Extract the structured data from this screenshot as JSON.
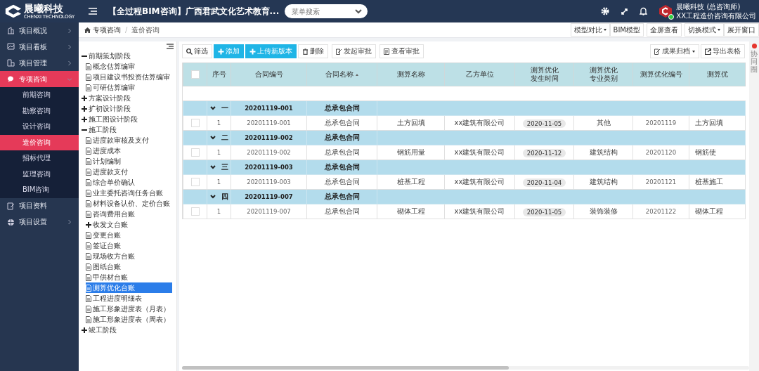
{
  "brand": {
    "name": "晨曦科技",
    "tagline": "CHENXI TECHNOLOGY"
  },
  "header": {
    "title": "【全过程BIM咨询】广西君武文化艺术教育...",
    "search_placeholder": "菜单搜索",
    "user_name": "晨曦科技 (总咨询师)",
    "company": "XX工程造价咨询有限公司",
    "online": true
  },
  "sidebar": {
    "items": [
      {
        "label": "项目概况",
        "selected": false,
        "expanded": false,
        "has_arrow": true
      },
      {
        "label": "项目看板",
        "selected": false,
        "expanded": false,
        "has_arrow": true
      },
      {
        "label": "项目管理",
        "selected": false,
        "expanded": false,
        "has_arrow": true
      },
      {
        "label": "专项咨询",
        "selected": true,
        "expanded": true,
        "has_arrow": true,
        "children": [
          {
            "label": "前期咨询",
            "selected": false
          },
          {
            "label": "勘察咨询",
            "selected": false
          },
          {
            "label": "设计咨询",
            "selected": false
          },
          {
            "label": "造价咨询",
            "selected": true
          },
          {
            "label": "招标代理",
            "selected": false
          },
          {
            "label": "监理咨询",
            "selected": false
          },
          {
            "label": "BIM咨询",
            "selected": false
          }
        ]
      },
      {
        "label": "项目资料",
        "selected": false,
        "expanded": false,
        "has_arrow": false
      },
      {
        "label": "项目设置",
        "selected": false,
        "expanded": false,
        "has_arrow": true
      }
    ]
  },
  "breadcrumb": {
    "separator": "/",
    "items": [
      "专项咨询",
      "造价咨询"
    ]
  },
  "view_buttons": [
    {
      "label": "模型对比",
      "dropdown": true
    },
    {
      "label": "BIM模型",
      "dropdown": false
    },
    {
      "label": "全屏查看",
      "dropdown": false
    },
    {
      "label": "切换模式",
      "dropdown": true
    },
    {
      "label": "展开窗口",
      "dropdown": false
    }
  ],
  "tree": [
    {
      "label": "前期策划阶段",
      "kind": "folder",
      "expanded": true,
      "selected": false,
      "children": [
        {
          "label": "概念估算编审",
          "kind": "doc",
          "selected": false
        },
        {
          "label": "项目建议书投资估算编审",
          "kind": "doc",
          "selected": false
        },
        {
          "label": "可研估算编审",
          "kind": "doc",
          "selected": false
        }
      ]
    },
    {
      "label": "方案设计阶段",
      "kind": "folder",
      "expanded": false,
      "selected": false
    },
    {
      "label": "扩初设计阶段",
      "kind": "folder",
      "expanded": false,
      "selected": false
    },
    {
      "label": "施工图设计阶段",
      "kind": "folder",
      "expanded": false,
      "selected": false
    },
    {
      "label": "施工阶段",
      "kind": "folder",
      "expanded": true,
      "selected": false,
      "children": [
        {
          "label": "进度款审核及支付",
          "kind": "doc",
          "selected": false
        },
        {
          "label": "进度成本",
          "kind": "doc",
          "selected": false
        },
        {
          "label": "计划编制",
          "kind": "doc",
          "selected": false
        },
        {
          "label": "进度款支付",
          "kind": "doc",
          "selected": false
        },
        {
          "label": "综合单价确认",
          "kind": "doc",
          "selected": false
        },
        {
          "label": "业主委托咨询任务台账",
          "kind": "doc",
          "selected": false
        },
        {
          "label": "材料设备认价、定价台账",
          "kind": "doc",
          "selected": false
        },
        {
          "label": "咨询费用台账",
          "kind": "doc",
          "selected": false
        },
        {
          "label": "收发文台账",
          "kind": "folder",
          "expanded": false,
          "selected": false
        },
        {
          "label": "变更台账",
          "kind": "doc",
          "selected": false
        },
        {
          "label": "签证台账",
          "kind": "doc",
          "selected": false
        },
        {
          "label": "现场收方台账",
          "kind": "doc",
          "selected": false
        },
        {
          "label": "图纸台账",
          "kind": "doc",
          "selected": false
        },
        {
          "label": "甲供材台账",
          "kind": "doc",
          "selected": false
        },
        {
          "label": "测算优化台账",
          "kind": "doc",
          "selected": true
        },
        {
          "label": "工程进度明细表",
          "kind": "doc",
          "selected": false
        },
        {
          "label": "施工形象进度表（月表）",
          "kind": "doc",
          "selected": false
        },
        {
          "label": "施工形象进度表（周表）",
          "kind": "doc",
          "selected": false
        }
      ]
    },
    {
      "label": "竣工阶段",
      "kind": "folder",
      "expanded": false,
      "selected": false
    }
  ],
  "toolbar": [
    {
      "label": "筛选",
      "kind": "search",
      "primary": false
    },
    {
      "label": "添加",
      "kind": "plus",
      "primary": true
    },
    {
      "label": "上传新版本",
      "kind": "plus",
      "primary": true
    },
    {
      "label": "删除",
      "kind": "trash",
      "primary": false
    },
    {
      "label": "发起审批",
      "kind": "edit",
      "primary": false
    },
    {
      "label": "查看审批",
      "kind": "doc",
      "primary": false
    }
  ],
  "toolbar_right": [
    {
      "label": "成果归档",
      "kind": "edit",
      "dropdown": true
    },
    {
      "label": "导出表格",
      "kind": "export",
      "dropdown": false
    }
  ],
  "table": {
    "select_all": false,
    "columns": [
      {
        "label": "序号",
        "sortable": false
      },
      {
        "label": "合同编号",
        "sortable": false
      },
      {
        "label": "合同名称",
        "sortable": true
      },
      {
        "label": "测算名称",
        "sortable": false
      },
      {
        "label": "乙方单位",
        "sortable": false
      },
      {
        "label": "测算优化发生时间",
        "sortable": false,
        "wrap": true
      },
      {
        "label": "测算优化专业类别",
        "sortable": false,
        "wrap": true
      },
      {
        "label": "测算优化编号",
        "sortable": false
      },
      {
        "label": "测算优",
        "sortable": false
      }
    ],
    "groups": [
      {
        "index": "一",
        "contract_no": "20201119-001",
        "contract_name": "总承包合同",
        "expanded": true,
        "rows": [
          {
            "checked": false,
            "cells": [
              "1",
              "20201119-001",
              "总承包合同",
              "土方回填",
              "xx建筑有限公司",
              "2020-11-05",
              "其他",
              "20201119",
              "土方回填"
            ]
          }
        ]
      },
      {
        "index": "二",
        "contract_no": "20201119-002",
        "contract_name": "总承包合同",
        "expanded": true,
        "rows": [
          {
            "checked": false,
            "cells": [
              "1",
              "20201119-002",
              "总承包合同",
              "钢筋用量",
              "xx建筑有限公司",
              "2020-11-12",
              "建筑结构",
              "20201120",
              "钢筋使"
            ]
          }
        ]
      },
      {
        "index": "三",
        "contract_no": "20201119-003",
        "contract_name": "总承包合同",
        "expanded": true,
        "rows": [
          {
            "checked": false,
            "cells": [
              "1",
              "20201119-003",
              "总承包合同",
              "桩基工程",
              "xx建筑有限公司",
              "2020-11-04",
              "建筑结构",
              "20201121",
              "桩基施工"
            ]
          }
        ]
      },
      {
        "index": "四",
        "contract_no": "20201119-007",
        "contract_name": "总承包合同",
        "expanded": true,
        "rows": [
          {
            "checked": false,
            "cells": [
              "1",
              "20201119-007",
              "总承包合同",
              "砌体工程",
              "xx建筑有限公司",
              "2020-11-05",
              "装饰装修",
              "20201122",
              "砌体工程"
            ]
          }
        ]
      }
    ]
  },
  "side_tab": {
    "label": "协同圈",
    "alert": true
  }
}
